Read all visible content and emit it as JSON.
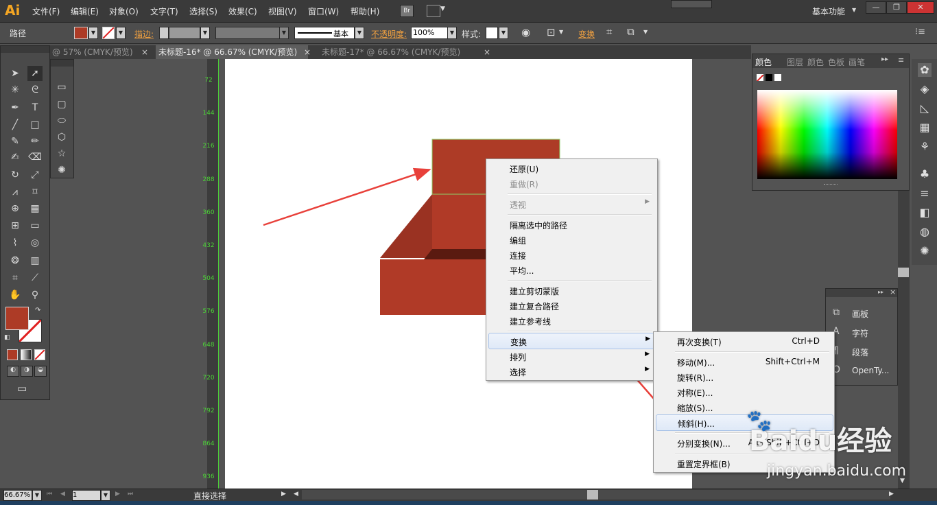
{
  "app": {
    "logo": "Ai",
    "workspace": "基本功能",
    "bridge_label": "Br"
  },
  "menu_bar": [
    "文件(F)",
    "编辑(E)",
    "对象(O)",
    "文字(T)",
    "选择(S)",
    "效果(C)",
    "视图(V)",
    "窗口(W)",
    "帮助(H)"
  ],
  "control_bar": {
    "object_type": "路径",
    "stroke_label": "描边:",
    "stroke_style": "基本",
    "opacity_label": "不透明度:",
    "opacity_value": "100%",
    "style_label": "样式:",
    "transform_label": "变换"
  },
  "tabs": [
    {
      "label": "@ 57% (CMYK/预览)",
      "active": false
    },
    {
      "label": "未标题-16* @ 66.67% (CMYK/预览)",
      "active": true
    },
    {
      "label": "未标题-17* @ 66.67% (CMYK/预览)",
      "active": false
    }
  ],
  "ruler_labels": [
    "72",
    "144",
    "216",
    "288",
    "360",
    "432",
    "504",
    "576",
    "648",
    "720",
    "792",
    "864",
    "936"
  ],
  "context_menu": {
    "items": [
      {
        "label": "还原(U)",
        "disabled": false
      },
      {
        "label": "重做(R)",
        "disabled": true
      },
      {
        "sep": true
      },
      {
        "label": "透视",
        "disabled": true,
        "submenu": true
      },
      {
        "sep": true
      },
      {
        "label": "隔离选中的路径"
      },
      {
        "label": "编组"
      },
      {
        "label": "连接"
      },
      {
        "label": "平均..."
      },
      {
        "sep": true
      },
      {
        "label": "建立剪切蒙版"
      },
      {
        "label": "建立复合路径"
      },
      {
        "label": "建立参考线"
      },
      {
        "sep": true
      },
      {
        "label": "变换",
        "submenu": true,
        "highlight": true
      },
      {
        "label": "排列",
        "submenu": true
      },
      {
        "label": "选择",
        "submenu": true
      }
    ]
  },
  "transform_submenu": {
    "items": [
      {
        "label": "再次变换(T)",
        "shortcut": "Ctrl+D"
      },
      {
        "sep": true
      },
      {
        "label": "移动(M)...",
        "shortcut": "Shift+Ctrl+M"
      },
      {
        "label": "旋转(R)..."
      },
      {
        "label": "对称(E)..."
      },
      {
        "label": "缩放(S)..."
      },
      {
        "label": "倾斜(H)...",
        "highlight": true
      },
      {
        "sep": true
      },
      {
        "label": "分别变换(N)...",
        "shortcut": "Alt+Shift+Ctrl+D"
      },
      {
        "sep": true
      },
      {
        "label": "重置定界框(B)"
      }
    ]
  },
  "color_panel": {
    "tabs": [
      "颜色",
      "图层",
      "颜色",
      "色板",
      "画笔"
    ]
  },
  "type_panel": {
    "items": [
      "画板",
      "字符",
      "段落",
      "OpenTy..."
    ]
  },
  "status_bar": {
    "zoom": "66.67%",
    "page": "1",
    "tool": "直接选择"
  },
  "watermark": {
    "brand": "Baidu经验",
    "url": "jingyan.baidu.com"
  },
  "colors": {
    "fill": "#ad3b26",
    "box_front": "#b03a27",
    "box_side": "#8f2e1f",
    "box_inner": "#5a1a10",
    "accent": "#f0a040",
    "ruler": "#4cd137",
    "arrow": "#e8403a"
  }
}
